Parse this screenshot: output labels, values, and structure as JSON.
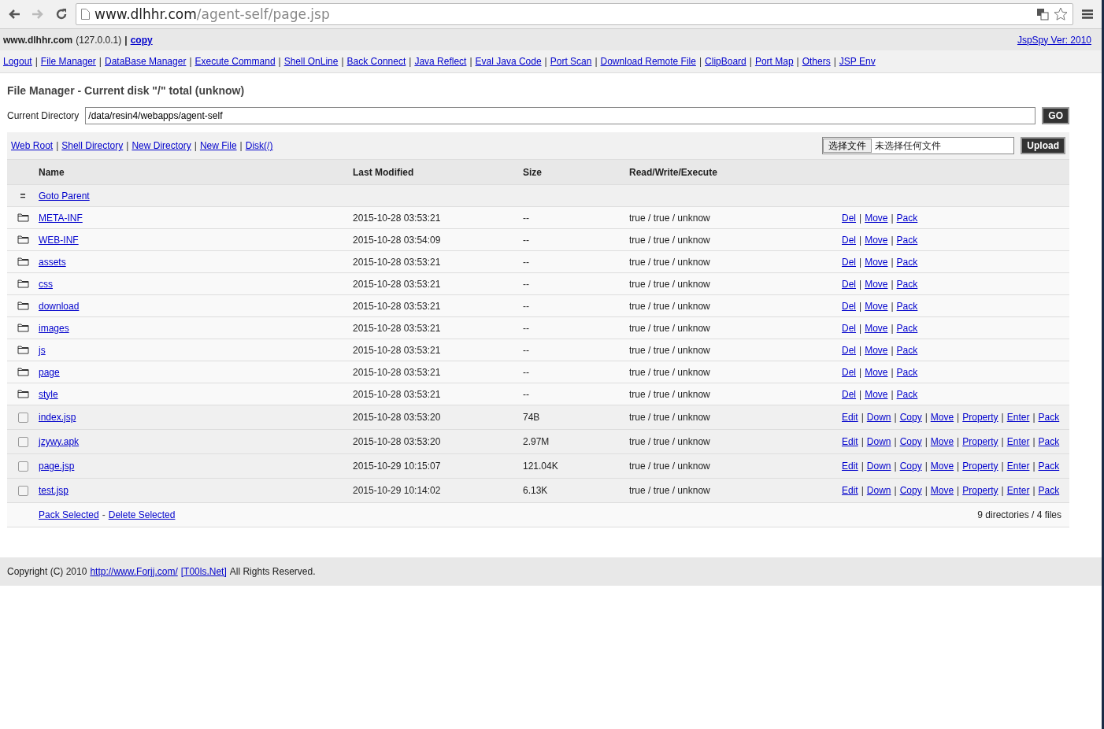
{
  "browser": {
    "url_host": "www.dlhhr.com",
    "url_path": "/agent-self/page.jsp"
  },
  "header": {
    "host": "www.dlhhr.com",
    "ip": "(127.0.0.1)",
    "separator": "|",
    "copy_link": "copy",
    "version_link": "JspSpy Ver: 2010"
  },
  "nav": {
    "separator": "|",
    "items": [
      "Logout",
      "File Manager",
      "DataBase Manager",
      "Execute Command",
      "Shell OnLine",
      "Back Connect",
      "Java Reflect",
      "Eval Java Code",
      "Port Scan",
      "Download Remote File",
      "ClipBoard",
      "Port Map",
      "Others",
      "JSP Env"
    ]
  },
  "title": "File Manager - Current disk \"/\" total (unknow)",
  "directory": {
    "label": "Current Directory",
    "value": "/data/resin4/webapps/agent-self",
    "button": "GO"
  },
  "toolbar": {
    "separator": "|",
    "links": [
      "Web Root",
      "Shell Directory",
      "New Directory",
      "New File",
      "Disk(/)"
    ],
    "file_button": "选择文件",
    "file_status": "未选择任何文件",
    "upload_button": "Upload"
  },
  "table": {
    "columns": [
      "Name",
      "Last Modified",
      "Size",
      "Read/Write/Execute"
    ],
    "separator": "|",
    "rows": [
      {
        "kind": "parent",
        "icon": "=",
        "name": "Goto Parent"
      },
      {
        "kind": "dir",
        "name": "META-INF",
        "modified": "2015-10-28 03:53:21",
        "size": "--",
        "rwe": "true / true / unknow",
        "actions": [
          "Del",
          "Move",
          "Pack"
        ]
      },
      {
        "kind": "dir",
        "name": "WEB-INF",
        "modified": "2015-10-28 03:54:09",
        "size": "--",
        "rwe": "true / true / unknow",
        "actions": [
          "Del",
          "Move",
          "Pack"
        ]
      },
      {
        "kind": "dir",
        "name": "assets",
        "modified": "2015-10-28 03:53:21",
        "size": "--",
        "rwe": "true / true / unknow",
        "actions": [
          "Del",
          "Move",
          "Pack"
        ]
      },
      {
        "kind": "dir",
        "name": "css",
        "modified": "2015-10-28 03:53:21",
        "size": "--",
        "rwe": "true / true / unknow",
        "actions": [
          "Del",
          "Move",
          "Pack"
        ]
      },
      {
        "kind": "dir",
        "name": "download",
        "modified": "2015-10-28 03:53:21",
        "size": "--",
        "rwe": "true / true / unknow",
        "actions": [
          "Del",
          "Move",
          "Pack"
        ]
      },
      {
        "kind": "dir",
        "name": "images",
        "modified": "2015-10-28 03:53:21",
        "size": "--",
        "rwe": "true / true / unknow",
        "actions": [
          "Del",
          "Move",
          "Pack"
        ]
      },
      {
        "kind": "dir",
        "name": "js",
        "modified": "2015-10-28 03:53:21",
        "size": "--",
        "rwe": "true / true / unknow",
        "actions": [
          "Del",
          "Move",
          "Pack"
        ]
      },
      {
        "kind": "dir",
        "name": "page",
        "modified": "2015-10-28 03:53:21",
        "size": "--",
        "rwe": "true / true / unknow",
        "actions": [
          "Del",
          "Move",
          "Pack"
        ]
      },
      {
        "kind": "dir",
        "name": "style",
        "modified": "2015-10-28 03:53:21",
        "size": "--",
        "rwe": "true / true / unknow",
        "actions": [
          "Del",
          "Move",
          "Pack"
        ]
      },
      {
        "kind": "file",
        "checked": false,
        "name": "index.jsp",
        "modified": "2015-10-28 03:53:20",
        "size": "74B",
        "rwe": "true / true / unknow",
        "actions": [
          "Edit",
          "Down",
          "Copy",
          "Move",
          "Property",
          "Enter",
          "Pack"
        ]
      },
      {
        "kind": "file",
        "checked": false,
        "name": "jzywy.apk",
        "modified": "2015-10-28 03:53:20",
        "size": "2.97M",
        "rwe": "true / true / unknow",
        "actions": [
          "Edit",
          "Down",
          "Copy",
          "Move",
          "Property",
          "Enter",
          "Pack"
        ]
      },
      {
        "kind": "file",
        "checked": false,
        "name": "page.jsp",
        "modified": "2015-10-29 10:15:07",
        "size": "121.04K",
        "rwe": "true / true / unknow",
        "actions": [
          "Edit",
          "Down",
          "Copy",
          "Move",
          "Property",
          "Enter",
          "Pack"
        ]
      },
      {
        "kind": "file",
        "checked": false,
        "name": "test.jsp",
        "modified": "2015-10-29 10:14:02",
        "size": "6.13K",
        "rwe": "true / true / unknow",
        "actions": [
          "Edit",
          "Down",
          "Copy",
          "Move",
          "Property",
          "Enter",
          "Pack"
        ]
      }
    ],
    "footer": {
      "links": [
        "Pack Selected",
        "Delete Selected"
      ],
      "joiner": "-",
      "summary": "9 directories / 4 files"
    }
  },
  "copyright": {
    "text": "Copyright (C) 2010",
    "links": [
      "http://www.Forjj.com/",
      "[T00ls.Net]"
    ],
    "suffix": "All Rights Reserved."
  }
}
